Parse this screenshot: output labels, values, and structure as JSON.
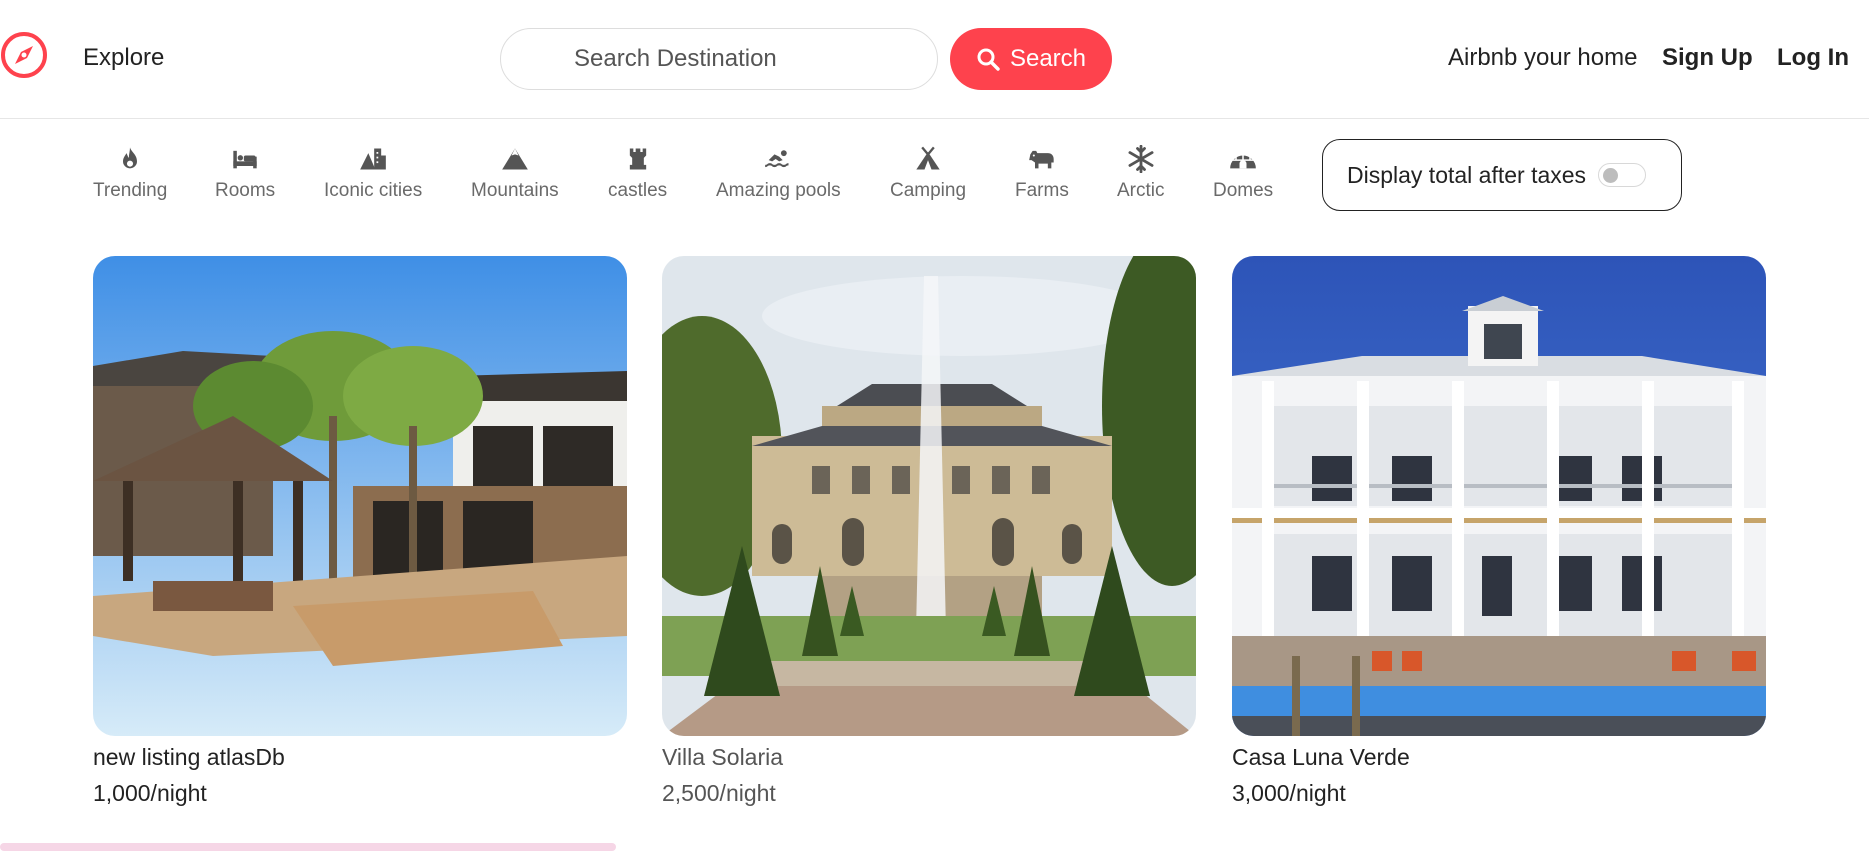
{
  "navbar": {
    "brand_icon": "compass-icon",
    "explore_label": "Explore",
    "search_placeholder": "Search Destination",
    "search_button_label": "Search",
    "airbnb_home_label": "Airbnb your home",
    "signup_label": "Sign Up",
    "login_label": "Log In",
    "accent_color": "#fe424d"
  },
  "filters": {
    "items": [
      {
        "label": "Trending",
        "icon": "fire-icon"
      },
      {
        "label": "Rooms",
        "icon": "bed-icon"
      },
      {
        "label": "Iconic cities",
        "icon": "mountain-city-icon"
      },
      {
        "label": "Mountains",
        "icon": "mountain-icon"
      },
      {
        "label": "castles",
        "icon": "chess-rook-icon"
      },
      {
        "label": "Amazing pools",
        "icon": "person-swimming-icon"
      },
      {
        "label": "Camping",
        "icon": "campground-icon"
      },
      {
        "label": "Farms",
        "icon": "cow-icon"
      },
      {
        "label": "Arctic",
        "icon": "snowflake-icon"
      },
      {
        "label": "Domes",
        "icon": "igloo-icon"
      }
    ],
    "tax_toggle_label": "Display total after taxes",
    "tax_toggle_on": false
  },
  "listings": [
    {
      "title": "new listing atlasDb",
      "price": "1,000/night"
    },
    {
      "title": "Villa Solaria",
      "price": "2,500/night"
    },
    {
      "title": "Casa Luna Verde",
      "price": "3,000/night"
    }
  ]
}
